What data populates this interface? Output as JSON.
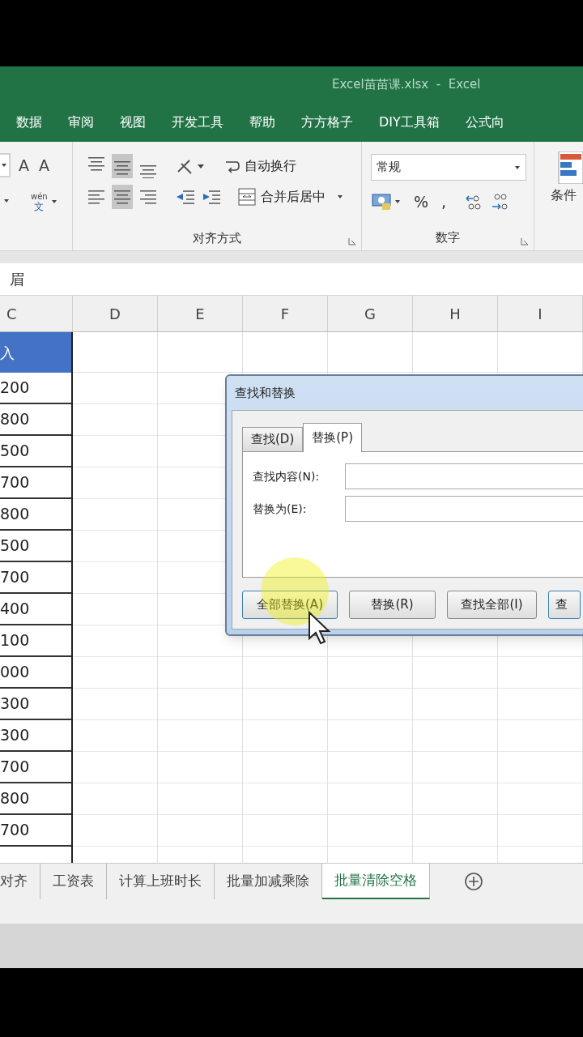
{
  "window": {
    "title": "Excel苗苗课.xlsx  -  Excel"
  },
  "ribbon_tabs": [
    "数据",
    "审阅",
    "视图",
    "开发工具",
    "帮助",
    "方方格子",
    "DIY工具箱",
    "公式向"
  ],
  "ribbon": {
    "font_buttons": [
      "A",
      "A"
    ],
    "phonetic": "wén",
    "phonetic_char": "文",
    "wrap_text": "自动换行",
    "merge_center": "合并后居中",
    "alignment_group": "对齐方式",
    "number_format": "常规",
    "number_buttons": [
      "%",
      ","
    ],
    "number_group": "数字",
    "conditional_format": "条件"
  },
  "formula_bar": {
    "value": "眉"
  },
  "columns": [
    "C",
    "D",
    "E",
    "F",
    "G",
    "H",
    "I"
  ],
  "column_c": {
    "header": "入",
    "values": [
      "200",
      "800",
      "500",
      "700",
      "800",
      "500",
      "700",
      "400",
      "100",
      "000",
      "300",
      "300",
      "700",
      "800",
      "700"
    ]
  },
  "sheet_tabs": [
    {
      "label": "对齐",
      "selected": false
    },
    {
      "label": "工资表",
      "selected": false
    },
    {
      "label": "计算上班时长",
      "selected": false
    },
    {
      "label": "批量加减乘除",
      "selected": false
    },
    {
      "label": "批量清除空格",
      "selected": true
    }
  ],
  "dialog": {
    "title": "查找和替换",
    "tabs": [
      {
        "label": "查找(D)",
        "selected": false
      },
      {
        "label": "替换(P)",
        "selected": true
      }
    ],
    "fields": [
      {
        "label": "查找内容(N):"
      },
      {
        "label": "替换为(E):"
      }
    ],
    "buttons": [
      "全部替换(A)",
      "替换(R)",
      "查找全部(I)",
      "查"
    ]
  }
}
